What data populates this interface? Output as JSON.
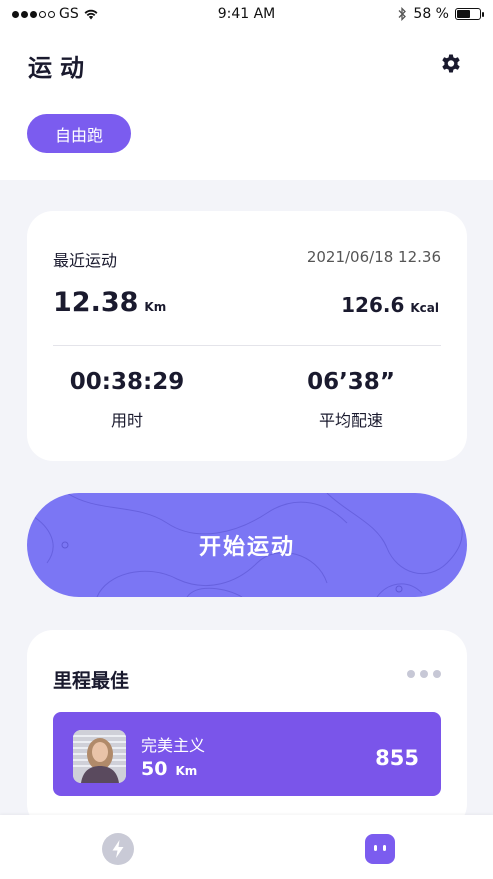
{
  "status_bar": {
    "carrier": "GS",
    "time": "9:41 AM",
    "battery": "58 %",
    "battery_level": 0.58
  },
  "header": {
    "title": "运动"
  },
  "mode_chip": {
    "label": "自由跑"
  },
  "recent": {
    "label": "最近运动",
    "date": "2021/06/18  12.36",
    "distance": "12.38",
    "distance_unit": "Km",
    "calories": "126.6",
    "calories_unit": "Kcal",
    "duration": "00:38:29",
    "duration_label": "用时",
    "pace": "06’38”",
    "pace_label": "平均配速"
  },
  "start_button": {
    "label": "开始运动"
  },
  "best": {
    "title": "里程最佳",
    "record": {
      "name": "完美主义",
      "distance": "50",
      "distance_unit": "Km",
      "score": "855"
    }
  },
  "icons": {
    "settings": "gear-icon",
    "more": "more-dots-icon",
    "tab_sport": "lightning-icon",
    "tab_me": "robot-face-icon"
  },
  "colors": {
    "accent": "#7b5cef",
    "start_button": "#7b76f4",
    "record_row": "#7a55ea",
    "background": "#f3f4f9"
  }
}
